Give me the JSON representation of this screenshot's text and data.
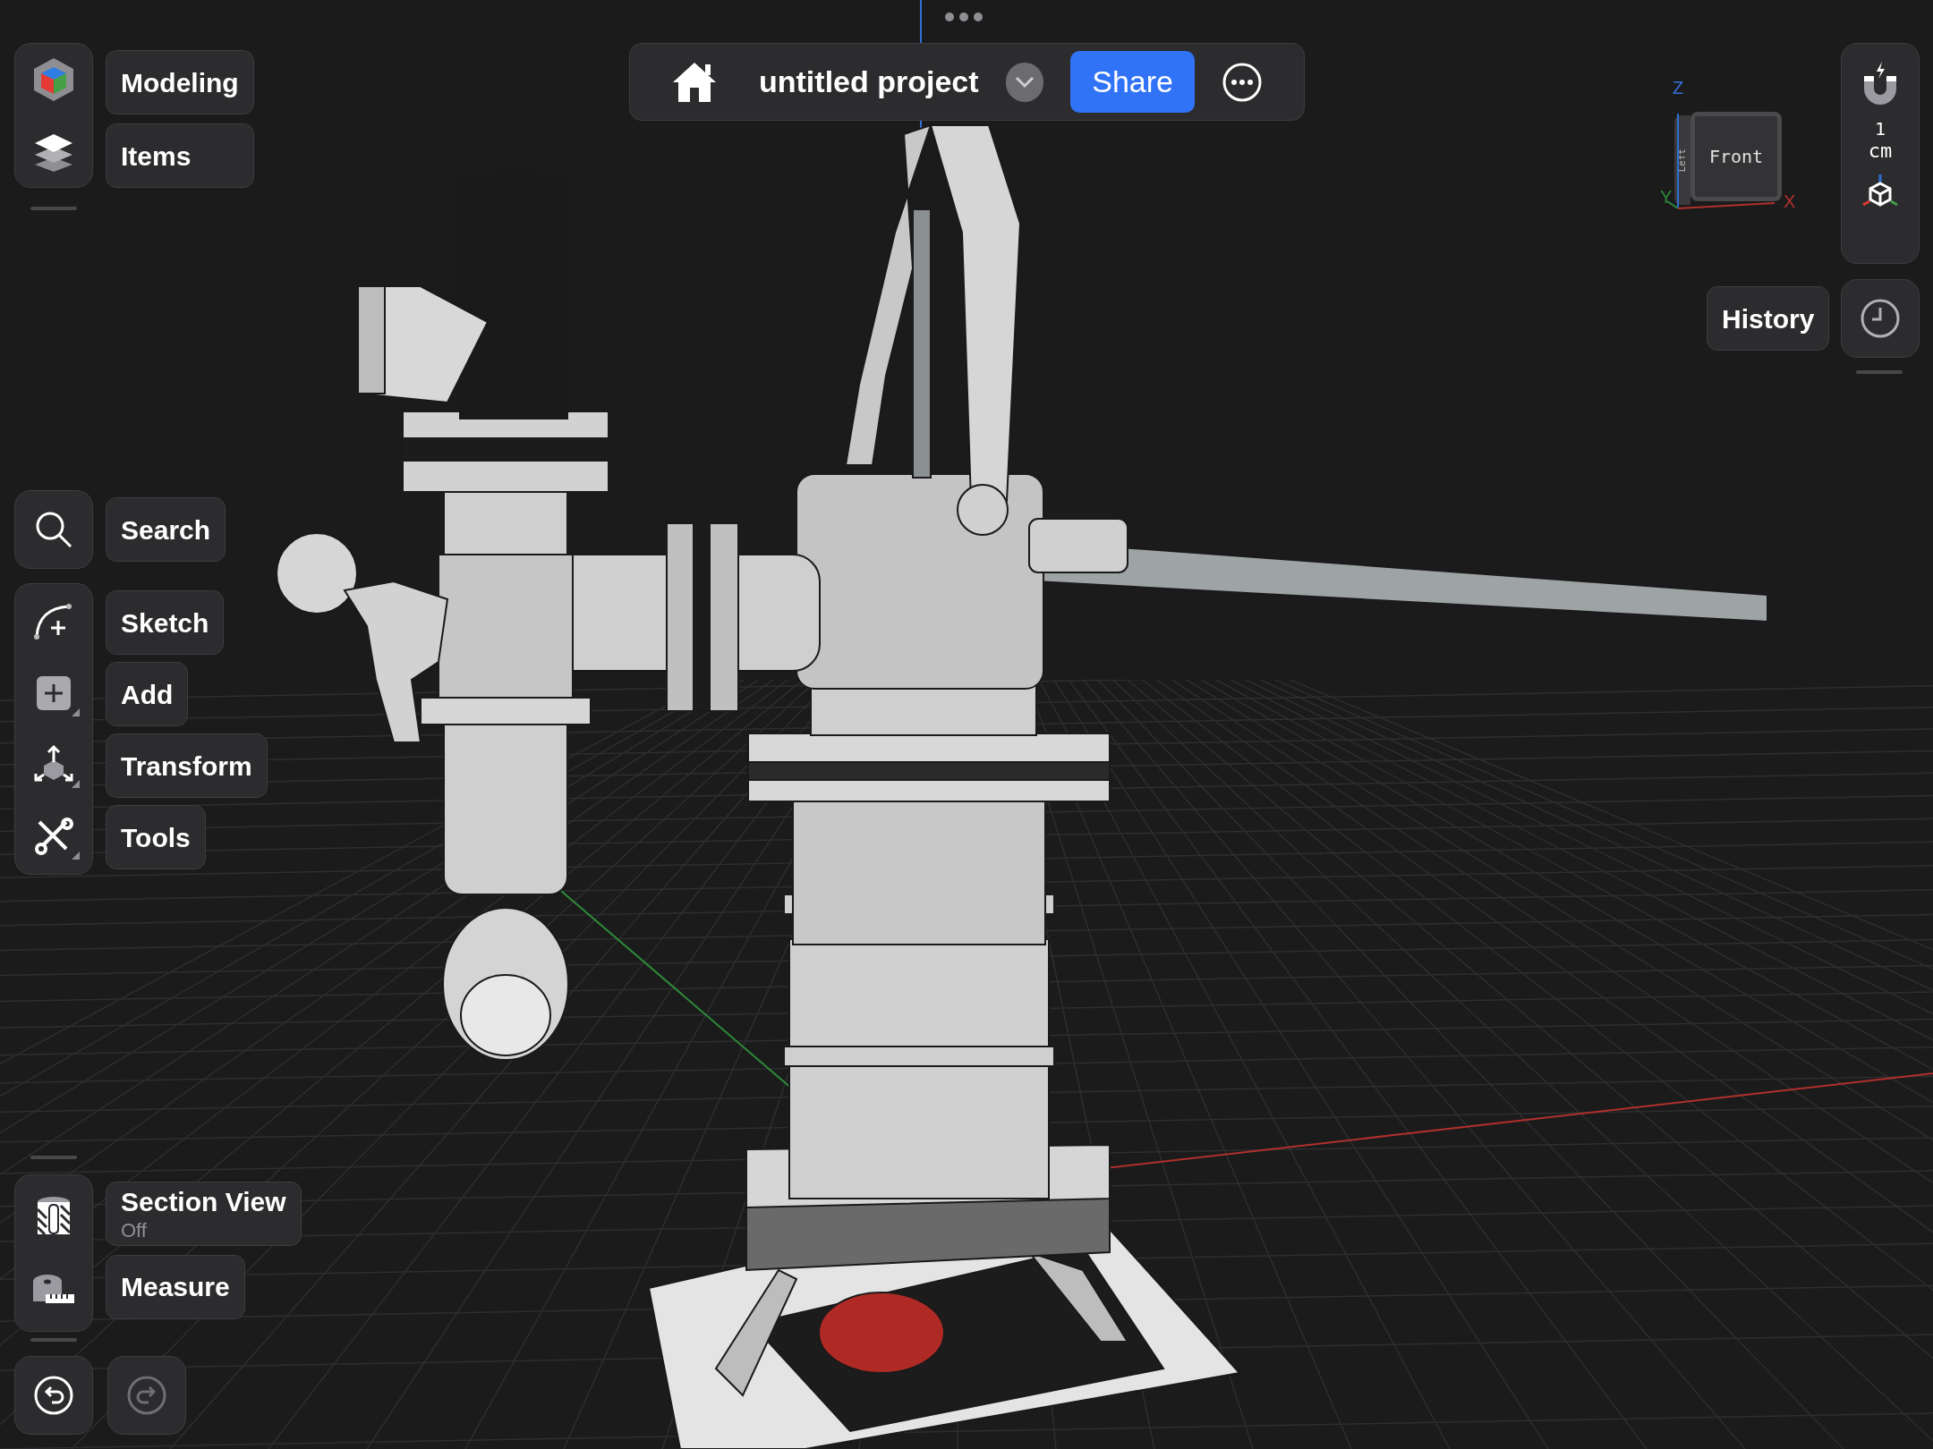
{
  "top_bar": {
    "project_name": "untitled project",
    "share_button": "Share"
  },
  "left_toolbar": {
    "top_group": [
      {
        "label": "Modeling",
        "kind": "modeling"
      },
      {
        "label": "Items",
        "kind": "items"
      }
    ],
    "search": {
      "label": "Search"
    },
    "tools": [
      {
        "label": "Sketch",
        "kind": "sketch"
      },
      {
        "label": "Add",
        "kind": "add"
      },
      {
        "label": "Transform",
        "kind": "transform"
      },
      {
        "label": "Tools",
        "kind": "tools"
      }
    ],
    "inspect": [
      {
        "label": "Section View",
        "status": "Off",
        "kind": "section"
      },
      {
        "label": "Measure",
        "kind": "measure"
      }
    ],
    "undo": {
      "disabled": false
    },
    "redo": {
      "disabled": true
    }
  },
  "view_cube": {
    "front": "Front",
    "left": "Left",
    "z_axis": "Z",
    "y_axis": "Y",
    "x_axis": "X"
  },
  "snap": {
    "grid_value": "1",
    "grid_unit": "cm"
  },
  "history": {
    "label": "History"
  }
}
